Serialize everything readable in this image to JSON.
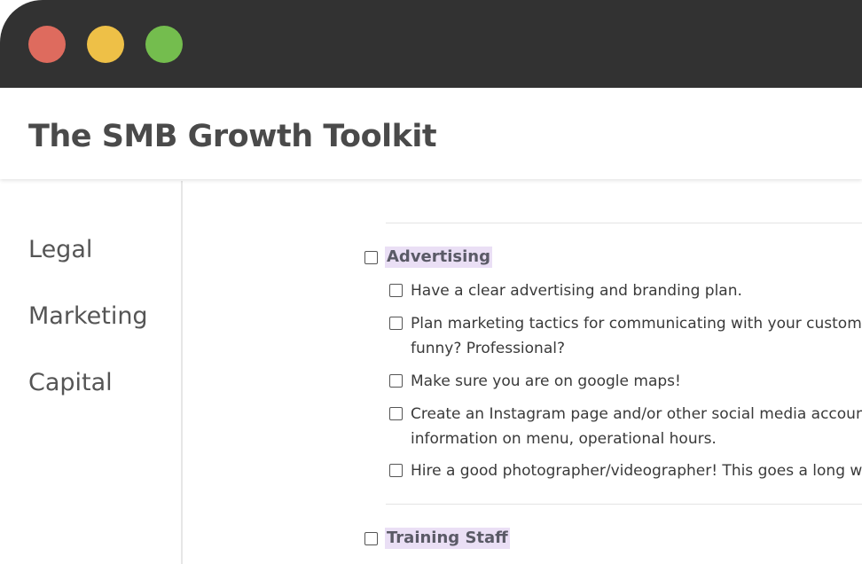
{
  "window": {
    "title": "The SMB Growth Toolkit",
    "controls": {
      "close_color": "#de6b5e",
      "minimize_color": "#eec047",
      "maximize_color": "#74bd4e"
    }
  },
  "sidebar": {
    "items": [
      {
        "label": "Legal"
      },
      {
        "label": "Marketing"
      },
      {
        "label": "Capital"
      }
    ]
  },
  "main": {
    "sections": [
      {
        "title": "Advertising",
        "highlight_color": "#eadff5",
        "checked": false,
        "tasks": [
          {
            "lines": [
              "Have a clear advertising and branding plan."
            ],
            "checked": false
          },
          {
            "lines": [
              "Plan marketing tactics for communicating with your customers",
              "funny? Professional?"
            ],
            "checked": false
          },
          {
            "lines": [
              "Make sure you are on google maps!"
            ],
            "checked": false
          },
          {
            "lines": [
              "Create an Instagram page and/or other social media accounts.",
              "information on menu, operational hours."
            ],
            "checked": false
          },
          {
            "lines": [
              "Hire a good photographer/videographer! This goes a long way"
            ],
            "checked": false
          }
        ]
      },
      {
        "title": "Training Staff",
        "highlight_color": "#eadff5",
        "checked": false,
        "tasks": []
      }
    ]
  }
}
